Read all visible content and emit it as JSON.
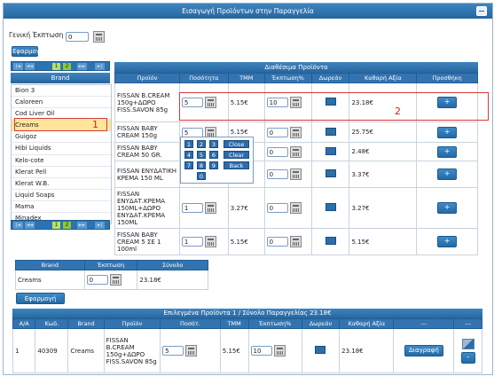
{
  "window": {
    "title": "Εισαγωγή Προϊόντων στην Παραγγελία"
  },
  "general_discount": {
    "label": "Γενική Έκπτωση",
    "value": "0"
  },
  "apply_label": "Εφαρμογή",
  "pager": {
    "first": "|◄",
    "prev": "◄◄",
    "pages": [
      "1",
      "2"
    ],
    "next": "►►",
    "last": "►|"
  },
  "brand_list": {
    "header": "Brand",
    "items": [
      "Bion 3",
      "Caloreen",
      "Cod Liver Oil",
      "Creams",
      "Guigoz",
      "Hibi Liquids",
      "Kelo-cote",
      "Klerat Pell",
      "Klerat W.B.",
      "Liquid Soaps",
      "Mama",
      "Minadex"
    ],
    "selected": "Creams"
  },
  "available": {
    "title": "Διαθέσιμα Προϊόντα",
    "columns": [
      "Προϊόν",
      "Ποσότητα",
      "ΤΜΜ",
      "Έκπτωση%",
      "Δωρεάν",
      "Καθαρή Αξία",
      "Προσθήκη"
    ],
    "rows": [
      {
        "product": "FISSAN B.CREAM 150g+ΔΩΡΟ FISS.SAVON 85g",
        "qty": "5",
        "tmm": "5.15€",
        "disc": "10",
        "net": "23.18€"
      },
      {
        "product": "FISSAN BABY CREAM 150g",
        "qty": "5",
        "tmm": "5.15€",
        "disc": "0",
        "net": "25.75€"
      },
      {
        "product": "FISSAN BABY CREAM 50 GR.",
        "qty": "",
        "tmm": "",
        "disc": "0",
        "net": "2.48€"
      },
      {
        "product": "FISSAN ΕΝΥΔΑΤΙΚΗ ΚΡΕΜΑ 150 ML",
        "qty": "",
        "tmm": "",
        "disc": "0",
        "net": "3.37€"
      },
      {
        "product": "FISSAN ΕΝΥΔΑΤ.ΚΡΕΜΑ 150ML+ΔΩΡΟ ΕΝΥΔΑΤ.ΚΡΕΜΑ 150ML",
        "qty": "1",
        "tmm": "3.27€",
        "disc": "0",
        "net": "3.27€"
      },
      {
        "product": "FISSAN BABY CREAM 5 ΣΕ 1 100ml",
        "qty": "1",
        "tmm": "5.15€",
        "disc": "0",
        "net": "5.15€"
      }
    ],
    "add_symbol": "+"
  },
  "keypad": {
    "keys": [
      "1",
      "2",
      "3",
      "Close",
      "4",
      "5",
      "6",
      "Clear",
      "7",
      "8",
      "9",
      "Back",
      "0"
    ]
  },
  "brand_discount": {
    "columns": [
      "Brand",
      "Έκπτωση",
      "Σύνολο"
    ],
    "brand": "Creams",
    "discount": "0",
    "total": "23.18€"
  },
  "selected": {
    "title": "Επιλεγμένα Προϊόντα 1 / Σύνολο Παραγγελίας 23.18€",
    "columns": [
      "Α/Α",
      "Κωδ.",
      "Brand",
      "Προϊόν",
      "Ποσότ.",
      "ΤΜΜ",
      "Έκπτωση%",
      "Δωρεάν",
      "Καθαρή Αξία",
      "---",
      "---"
    ],
    "row": {
      "aa": "1",
      "code": "40309",
      "brand": "Creams",
      "product": "FISSAN B.CREAM 150g+ΔΩΡΟ FISS.SAVON 85g",
      "qty": "5",
      "tmm": "5.15€",
      "disc": "10",
      "net": "23.18€",
      "delete": "Διαγραφή",
      "minus": "-"
    }
  },
  "annotations": {
    "one": "1",
    "two": "2"
  },
  "colors": {
    "header_blue": "#2f72ae",
    "selected_brand": "#ffe69a",
    "pager_green": "#8cc63f",
    "annotation_red": "#d62020"
  }
}
